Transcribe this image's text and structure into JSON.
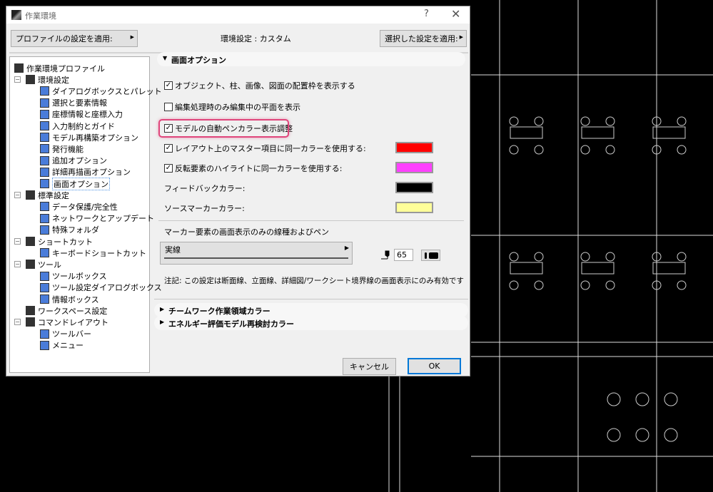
{
  "dialog": {
    "title": "作業環境",
    "help": "?",
    "close": "✕",
    "apply_profile_button": "プロファイルの設定を適用:",
    "current_setting": "環境設定 : カスタム",
    "apply_selected_button": "選択した設定を適用:",
    "cancel_button": "キャンセル",
    "ok_button": "OK"
  },
  "tree": [
    {
      "label": "作業環境プロファイル",
      "level": 0
    },
    {
      "label": "環境設定",
      "level": 1,
      "expanded": true
    },
    {
      "label": "ダイアログボックスとパレット",
      "level": 2
    },
    {
      "label": "選択と要素情報",
      "level": 2
    },
    {
      "label": "座標情報と座標入力",
      "level": 2
    },
    {
      "label": "入力制約とガイド",
      "level": 2
    },
    {
      "label": "モデル再構築オプション",
      "level": 2
    },
    {
      "label": "発行機能",
      "level": 2
    },
    {
      "label": "追加オプション",
      "level": 2
    },
    {
      "label": "詳細再描画オプション",
      "level": 2
    },
    {
      "label": "画面オプション",
      "level": 2,
      "selected": true
    },
    {
      "label": "標準設定",
      "level": 1,
      "expanded": true
    },
    {
      "label": "データ保護/完全性",
      "level": 2
    },
    {
      "label": "ネットワークとアップデート",
      "level": 2
    },
    {
      "label": "特殊フォルダ",
      "level": 2
    },
    {
      "label": "ショートカット",
      "level": 1,
      "expanded": true
    },
    {
      "label": "キーボードショートカット",
      "level": 2
    },
    {
      "label": "ツール",
      "level": 1,
      "expanded": true
    },
    {
      "label": "ツールボックス",
      "level": 2
    },
    {
      "label": "ツール設定ダイアログボックス",
      "level": 2
    },
    {
      "label": "情報ボックス",
      "level": 2
    },
    {
      "label": "ワークスペース設定",
      "level": 1
    },
    {
      "label": "コマンドレイアウト",
      "level": 1,
      "expanded": true
    },
    {
      "label": "ツールバー",
      "level": 2
    },
    {
      "label": "メニュー",
      "level": 2
    }
  ],
  "panel": {
    "section_title": "画面オプション",
    "options": [
      {
        "label": "オブジェクト、柱、画像、図面の配置枠を表示する",
        "checked": true
      },
      {
        "label": "編集処理時のみ編集中の平面を表示",
        "checked": false
      },
      {
        "label": "モデルの自動ペンカラー表示調整",
        "checked": true,
        "highlighted": true
      },
      {
        "label": "レイアウト上のマスター項目に同一カラーを使用する:",
        "checked": true,
        "color": "#ff0000"
      },
      {
        "label": "反転要素のハイライトに同一カラーを使用する:",
        "checked": true,
        "color": "#ff40ff"
      }
    ],
    "feedback_color_label": "フィードバックカラー:",
    "feedback_color": "#000000",
    "source_marker_label": "ソースマーカーカラー:",
    "source_marker_color": "#ffff99",
    "marker_line_label": "マーカー要素の画面表示のみの線種およびペン",
    "line_type": "実線",
    "pen_number": "65",
    "note": "注記: この設定は断面線、立面線、詳細図/ワークシート境界線の画面表示にのみ有効です",
    "collapsed_sections": [
      "チームワーク作業領域カラー",
      "エネルギー評価モデル再検討カラー"
    ]
  },
  "colors": {
    "highlight": "#e0457b",
    "accent": "#0078d7"
  }
}
